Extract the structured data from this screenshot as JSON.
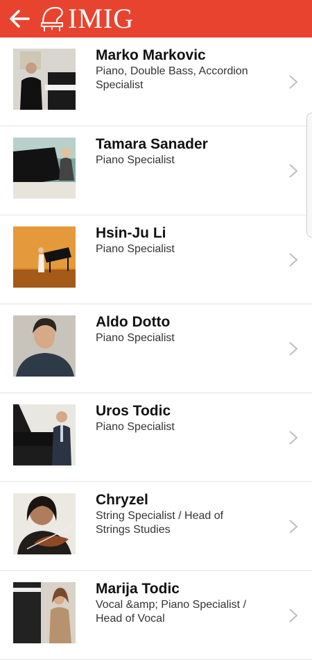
{
  "header": {
    "back_icon": "arrow-left-icon",
    "logo_icon": "grand-piano-icon",
    "logo_text": "IMIG",
    "color": "#e8432f"
  },
  "teachers": [
    {
      "name": "Marko Markovic",
      "role": "Piano, Double Bass, Accordion Specialist"
    },
    {
      "name": "Tamara Sanader",
      "role": "Piano Specialist"
    },
    {
      "name": "Hsin-Ju Li",
      "role": "Piano Specialist"
    },
    {
      "name": "Aldo Dotto",
      "role": "Piano Specialist"
    },
    {
      "name": "Uros Todic",
      "role": "Piano Specialist"
    },
    {
      "name": "Chryzel",
      "role": "String Specialist / Head of Strings Studies"
    },
    {
      "name": "Marija Todic",
      "role": "Vocal &amp; Piano Specialist / Head of Vocal"
    }
  ]
}
